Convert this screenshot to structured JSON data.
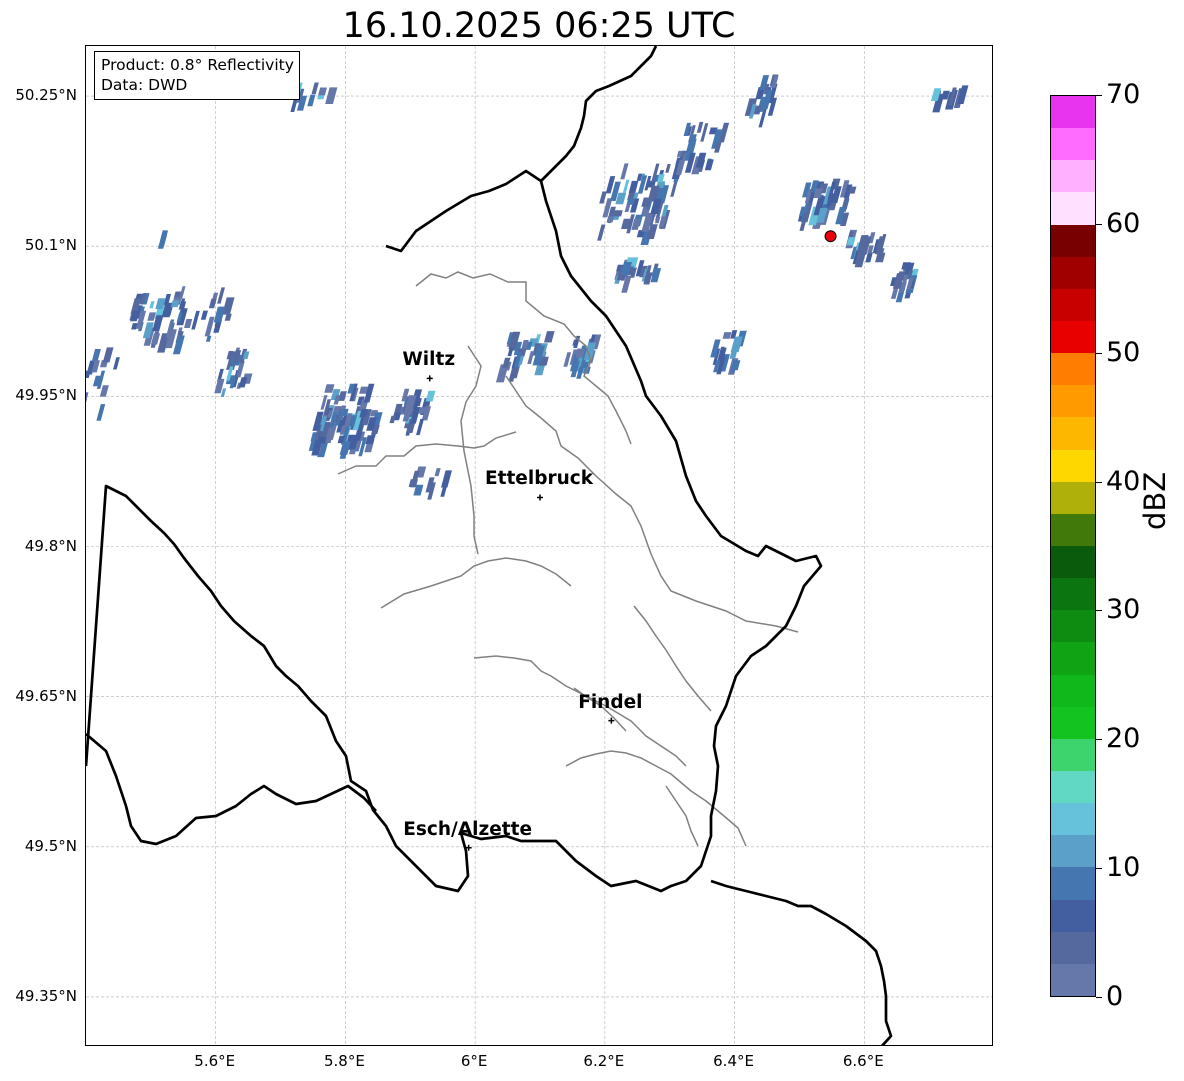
{
  "title": "16.10.2025 06:25 UTC",
  "info": {
    "product": "Product: 0.8° Reflectivity",
    "source": "Data: DWD"
  },
  "axes": {
    "lon_range": [
      5.4,
      6.8
    ],
    "lat_range": [
      49.3,
      50.3
    ],
    "lon_ticks": [
      {
        "value": 5.6,
        "label": "5.6°E"
      },
      {
        "value": 5.8,
        "label": "5.8°E"
      },
      {
        "value": 6.0,
        "label": "6°E"
      },
      {
        "value": 6.2,
        "label": "6.2°E"
      },
      {
        "value": 6.4,
        "label": "6.4°E"
      },
      {
        "value": 6.6,
        "label": "6.6°E"
      }
    ],
    "lat_ticks": [
      {
        "value": 50.25,
        "label": "50.25°N"
      },
      {
        "value": 50.1,
        "label": "50.1°N"
      },
      {
        "value": 49.95,
        "label": "49.95°N"
      },
      {
        "value": 49.8,
        "label": "49.8°N"
      },
      {
        "value": 49.65,
        "label": "49.65°N"
      },
      {
        "value": 49.5,
        "label": "49.5°N"
      },
      {
        "value": 49.35,
        "label": "49.35°N"
      }
    ],
    "grid": true
  },
  "cities": [
    {
      "name": "Wiltz",
      "lon": 5.93,
      "lat": 49.968
    },
    {
      "name": "Ettelbruck",
      "lon": 6.1,
      "lat": 49.849
    },
    {
      "name": "Findel",
      "lon": 6.21,
      "lat": 49.626
    },
    {
      "name": "Esch/Alzette",
      "lon": 5.99,
      "lat": 49.499
    }
  ],
  "radar_site": {
    "lon": 6.548,
    "lat": 50.11,
    "color": "#e8000b"
  },
  "colorbar": {
    "label": "dBZ",
    "min": 0,
    "max": 70,
    "ticks": [
      0,
      10,
      20,
      30,
      40,
      50,
      60,
      70
    ],
    "colors": [
      "#6677aa",
      "#55699f",
      "#445f9f",
      "#4676af",
      "#5aa0c8",
      "#66c1db",
      "#61d8c3",
      "#3dd36d",
      "#13c421",
      "#10b81b",
      "#10a415",
      "#0e8c12",
      "#0b7610",
      "#0a5c0c",
      "#417a0a",
      "#afb10a",
      "#fed700",
      "#feb700",
      "#ff9b00",
      "#ff7d00",
      "#e80000",
      "#c80000",
      "#a00000",
      "#780000",
      "#ffe1ff",
      "#ffb1ff",
      "#ff6cff",
      "#e834ee"
    ]
  }
}
